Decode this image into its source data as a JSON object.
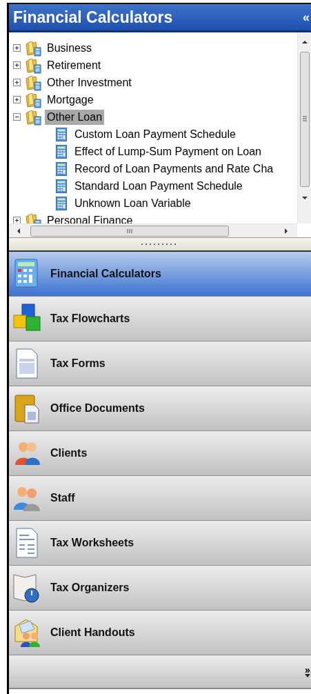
{
  "header": {
    "title": "Financial Calculators",
    "collapse_glyph": "«"
  },
  "tree": {
    "items": [
      {
        "label": "Business",
        "kind": "folder",
        "expanded": false,
        "selected": false
      },
      {
        "label": "Retirement",
        "kind": "folder",
        "expanded": false,
        "selected": false
      },
      {
        "label": "Other Investment",
        "kind": "folder",
        "expanded": false,
        "selected": false
      },
      {
        "label": "Mortgage",
        "kind": "folder",
        "expanded": false,
        "selected": false
      },
      {
        "label": "Other Loan",
        "kind": "folder",
        "expanded": true,
        "selected": true,
        "children": [
          {
            "label": "Custom Loan Payment Schedule",
            "kind": "calculator",
            "selected": false
          },
          {
            "label": "Effect of Lump-Sum Payment on Loan",
            "kind": "calculator",
            "selected": false
          },
          {
            "label": "Record of Loan Payments and Rate Cha",
            "kind": "calculator",
            "selected": false
          },
          {
            "label": "Standard Loan Payment Schedule",
            "kind": "calculator",
            "selected": false
          },
          {
            "label": "Unknown Loan Variable",
            "kind": "calculator",
            "selected": false
          }
        ]
      },
      {
        "label": "Personal Finance",
        "kind": "folder",
        "expanded": false,
        "selected": false
      }
    ]
  },
  "nav": {
    "items": [
      {
        "label": "Financial Calculators",
        "selected": true
      },
      {
        "label": "Tax Flowcharts",
        "selected": false
      },
      {
        "label": "Tax Forms",
        "selected": false
      },
      {
        "label": "Office Documents",
        "selected": false
      },
      {
        "label": "Clients",
        "selected": false
      },
      {
        "label": "Staff",
        "selected": false
      },
      {
        "label": "Tax Worksheets",
        "selected": false
      },
      {
        "label": "Tax Organizers",
        "selected": false
      },
      {
        "label": "Client Handouts",
        "selected": false
      }
    ],
    "overflow_glyph": "»"
  }
}
